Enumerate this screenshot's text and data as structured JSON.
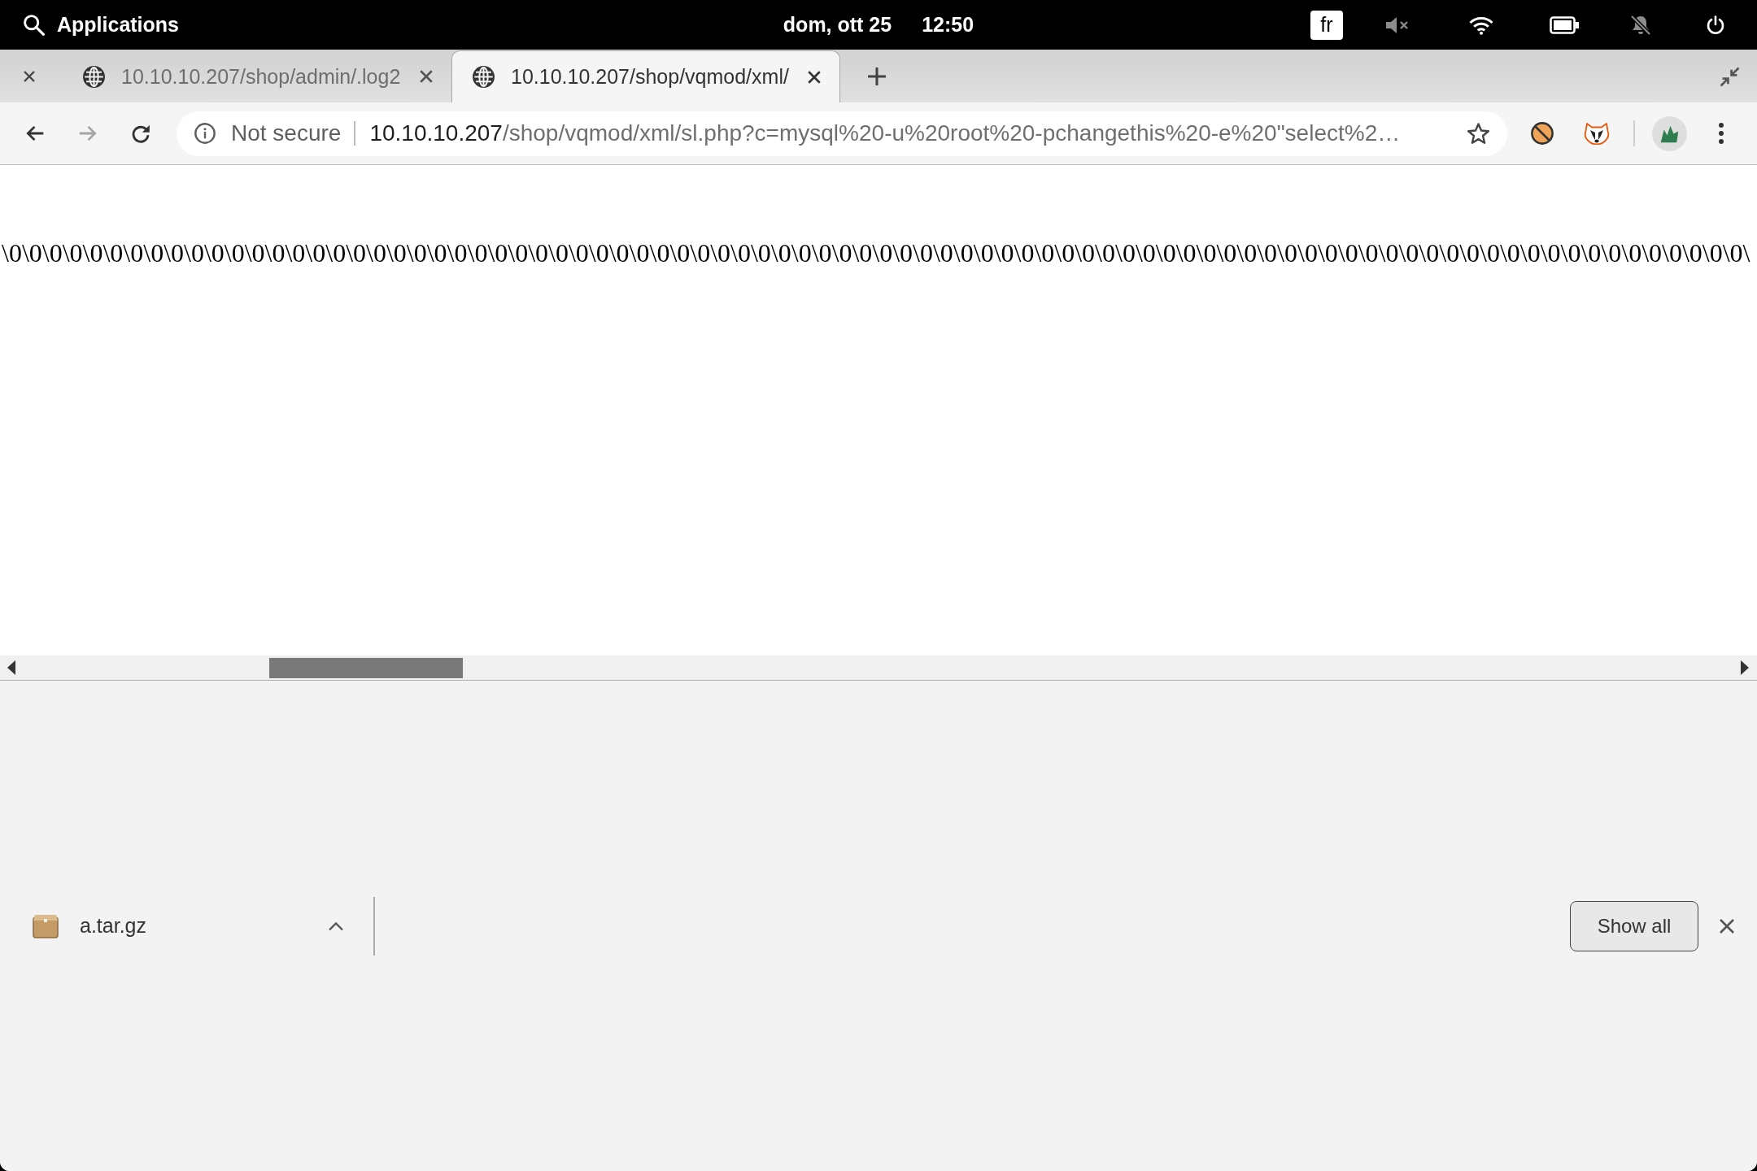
{
  "top_bar": {
    "launcher": "Applications",
    "date": "dom, ott 25",
    "time": "12:50",
    "keyboard_layout": "fr",
    "sound_muted": true,
    "notifications_muted": true
  },
  "tabs": [
    {
      "title": "10.10.10.207/shop/admin/.log2",
      "selected": false
    },
    {
      "title": "10.10.10.207/shop/vqmod/xml/",
      "selected": true
    }
  ],
  "nav_buttons": [
    {
      "kind": "back",
      "disabled": false
    },
    {
      "kind": "forward",
      "disabled": true
    },
    {
      "kind": "reload",
      "disabled": false
    }
  ],
  "address_bar": {
    "security_label": "Not secure",
    "url_host": "10.10.10.207",
    "url_path": "/shop/vqmod/xml/sl.php?c=mysql%20-u%20root%20-pchangethis%20-e%20\"select%2…"
  },
  "page": {
    "text": "\\0\\0\\0\\0\\0\\0\\0\\0\\0\\0\\0\\0\\0\\0\\0\\0\\0\\0\\0\\0\\0\\0\\0\\0\\0\\0\\0\\0\\0\\0\\0\\0\\0\\0\\0\\0\\0\\0\\0\\0\\0\\0\\0\\0\\0\\0\\0\\0\\0\\0\\0\\0\\0\\0\\0\\0\\0\\0\\0\\0\\0\\0\\0\\0\\0\\0\\0\\0\\0\\0\\0\\0\\0\\0\\0\\0\\0\\0\\0\\0\\0\\0\\0\\0\\0\\0\\"
  },
  "download_shelf": {
    "downloads": [
      {
        "file_name": "a.tar.gz"
      }
    ],
    "show_all": "Show all"
  }
}
